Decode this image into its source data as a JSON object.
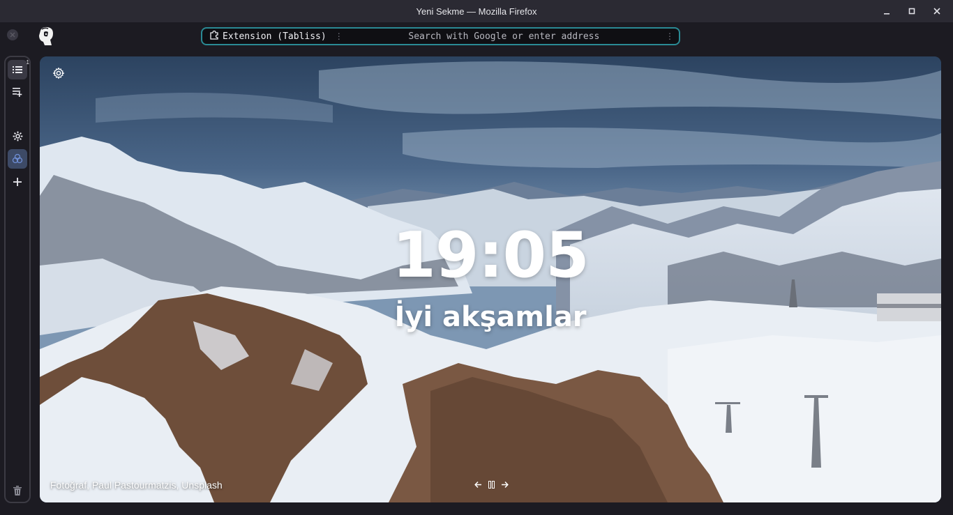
{
  "window": {
    "title": "Yeni Sekme — Mozilla Firefox"
  },
  "urlbar": {
    "extension_label": "Extension (Tabliss)",
    "placeholder": "Search with Google or enter address"
  },
  "sidebar": {
    "tab_count_badge": "1",
    "items": [
      {
        "name": "tabs-list",
        "icon": "list-icon"
      },
      {
        "name": "new-tab-group",
        "icon": "playlist-add-icon"
      },
      {
        "name": "settings",
        "icon": "gear-icon"
      },
      {
        "name": "workspace",
        "icon": "spaces-icon"
      },
      {
        "name": "add",
        "icon": "plus-icon"
      },
      {
        "name": "trash",
        "icon": "trash-icon"
      }
    ]
  },
  "page": {
    "time": "19:05",
    "greeting": "İyi akşamlar",
    "photo_credit": "Fotoğraf, Paul Pastourmatzis, Unsplash"
  },
  "colors": {
    "accent_border": "#2a8a94",
    "chrome_bg": "#1c1b22",
    "titlebar_bg": "#2b2a33"
  }
}
